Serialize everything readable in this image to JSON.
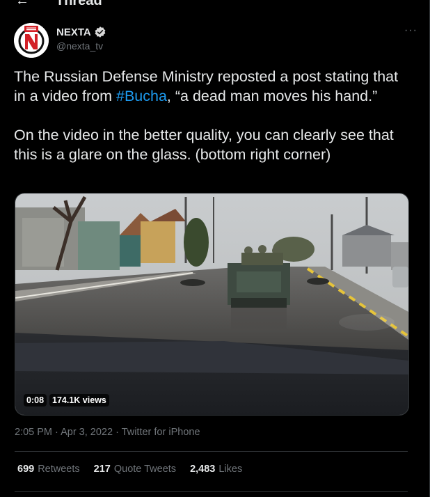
{
  "header": {
    "title": "Thread"
  },
  "tweet": {
    "author_name": "NEXTA",
    "author_handle": "@nexta_tv",
    "more_label": "···",
    "text_p1_a": "The Russian Defense Ministry reposted a post stating that in a video from ",
    "hashtag": "#Bucha",
    "text_p1_b": ", “a dead man moves his hand.”",
    "text_p2": "On the video in the better quality, you can clearly see that this is a glare on the glass. (bottom right corner)",
    "video_duration": "0:08",
    "video_views": "174.1K views",
    "timestamp": "2:05 PM · Apr 3, 2022 · Twitter for iPhone",
    "retweets_count": "699",
    "retweets_label": "Retweets",
    "quotes_count": "217",
    "quotes_label": "Quote Tweets",
    "likes_count": "2,483",
    "likes_label": "Likes"
  },
  "colors": {
    "background": "#000000",
    "text": "#e7e9ea",
    "muted": "#71767b",
    "link": "#1d9bf0",
    "border": "#2f3336"
  }
}
